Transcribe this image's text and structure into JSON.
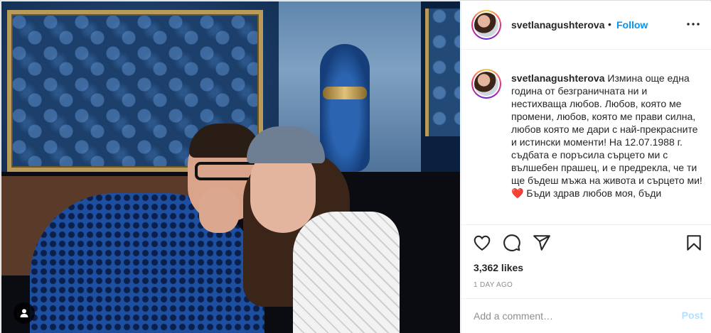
{
  "post": {
    "username": "svetlanagushterova",
    "follow_label": "Follow",
    "dot": "•",
    "caption_text": "Измина още една година от безграничната ни и нестихваща любов. Любов, която ме промени, любов, която ме прави силна, любов която ме дари с най-прекрасните и истински моменти! На 12.07.1988 г. съдбата е поръсила сърцето ми с вълшебен прашец, и е предрекла, че ти ще бъдеш мъжа на живота и сърцето ми! ❤️ Бъди здрав любов моя, бъди",
    "likes": "3,362 likes",
    "time_ago": "1 DAY AGO"
  },
  "comment": {
    "placeholder": "Add a comment…",
    "post_label": "Post"
  },
  "icons": {
    "more": "more-options-icon",
    "like": "heart-icon",
    "comment": "comment-icon",
    "share": "share-icon",
    "save": "bookmark-icon",
    "tagged": "user-tag-icon"
  },
  "colors": {
    "follow": "#0095f6",
    "post_disabled": "#b2dffc",
    "heart": "#ed4956"
  }
}
